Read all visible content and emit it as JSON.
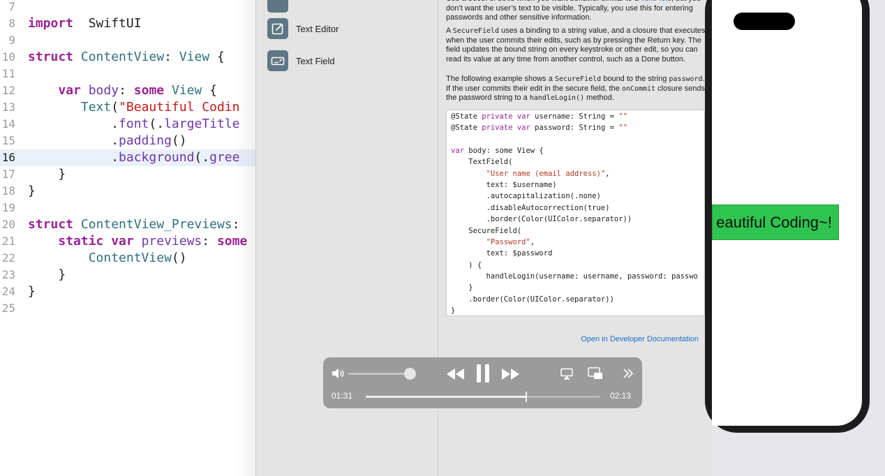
{
  "editor": {
    "lines": [
      {
        "n": "7",
        "parts": []
      },
      {
        "n": "8",
        "parts": [
          [
            "k",
            "import"
          ],
          [
            "",
            "  SwiftUI"
          ]
        ]
      },
      {
        "n": "9",
        "parts": []
      },
      {
        "n": "10",
        "parts": [
          [
            "k",
            "struct"
          ],
          [
            "",
            " "
          ],
          [
            "t",
            "ContentView"
          ],
          [
            "",
            ": "
          ],
          [
            "t",
            "View"
          ],
          [
            "",
            " {"
          ]
        ]
      },
      {
        "n": "11",
        "parts": []
      },
      {
        "n": "12",
        "parts": [
          [
            "",
            " "
          ],
          [
            "k",
            "   var"
          ],
          [
            "",
            " "
          ],
          [
            "p",
            "body"
          ],
          [
            "",
            ": "
          ],
          [
            "k",
            "some"
          ],
          [
            "",
            " "
          ],
          [
            "t",
            "View"
          ],
          [
            "",
            " {"
          ]
        ]
      },
      {
        "n": "13",
        "parts": [
          [
            "",
            "       "
          ],
          [
            "t",
            "Text"
          ],
          [
            "",
            "("
          ],
          [
            "s",
            "\"Beautiful Codin"
          ]
        ]
      },
      {
        "n": "14",
        "parts": [
          [
            "",
            "           ."
          ],
          [
            "p",
            "font"
          ],
          [
            "",
            "(."
          ],
          [
            "p",
            "largeTitle"
          ]
        ]
      },
      {
        "n": "15",
        "parts": [
          [
            "",
            "           ."
          ],
          [
            "p",
            "padding"
          ],
          [
            "",
            "()"
          ]
        ]
      },
      {
        "n": "16",
        "parts": [
          [
            "",
            "           ."
          ],
          [
            "p",
            "background"
          ],
          [
            "",
            "(."
          ],
          [
            "p",
            "gree"
          ]
        ]
      },
      {
        "n": "17",
        "parts": [
          [
            "",
            "    }"
          ]
        ]
      },
      {
        "n": "18",
        "parts": [
          [
            "",
            "}"
          ]
        ]
      },
      {
        "n": "19",
        "parts": []
      },
      {
        "n": "20",
        "parts": [
          [
            "k",
            "struct"
          ],
          [
            "",
            " "
          ],
          [
            "t",
            "ContentView_Previews"
          ],
          [
            "",
            ":"
          ]
        ]
      },
      {
        "n": "21",
        "parts": [
          [
            "",
            "    "
          ],
          [
            "k",
            "static var"
          ],
          [
            "",
            " "
          ],
          [
            "p",
            "previews"
          ],
          [
            "",
            ": "
          ],
          [
            "k",
            "some"
          ]
        ]
      },
      {
        "n": "22",
        "parts": [
          [
            "",
            "        "
          ],
          [
            "t",
            "ContentView"
          ],
          [
            "",
            "()"
          ]
        ]
      },
      {
        "n": "23",
        "parts": [
          [
            "",
            "    }"
          ]
        ]
      },
      {
        "n": "24",
        "parts": [
          [
            "",
            "}"
          ]
        ]
      },
      {
        "n": "25",
        "parts": []
      }
    ],
    "current_line": "16"
  },
  "library": {
    "items": [
      {
        "label": "Text Editor",
        "icon": "text-editor-icon"
      },
      {
        "label": "Text Field",
        "icon": "text-field-icon"
      }
    ]
  },
  "doc": {
    "p1": [
      [
        "",
        "Use a "
      ],
      [
        "m",
        "SecureField"
      ],
      [
        "",
        " when you want behavior similar to a "
      ],
      [
        "a",
        "TextField"
      ],
      [
        "",
        ", but you don’t want the user’s text to be visible. Typically, you use this for entering passwords and other sensitive information."
      ]
    ],
    "p2": [
      [
        "",
        "A "
      ],
      [
        "m",
        "SecureField"
      ],
      [
        "",
        " uses a binding to a string value, and a closure that executes when the user commits their edits, such as by pressing the Return key. The field updates the bound string on every keystroke or other edit, so you can read its value at any time from another control, such as a Done button."
      ]
    ],
    "p3": [
      [
        "",
        "The following example shows a "
      ],
      [
        "m",
        "SecureField"
      ],
      [
        "",
        " bound to the string "
      ],
      [
        "m",
        "password"
      ],
      [
        "",
        ". If the user commits their edit in the secure field, the "
      ],
      [
        "m",
        "on"
      ],
      [
        "m",
        "Commit"
      ],
      [
        "",
        " closure sends the password string to a "
      ],
      [
        "m",
        "handleLogin()"
      ],
      [
        "",
        " method."
      ]
    ],
    "code": [
      [
        [
          "",
          "@State "
        ],
        [
          "k",
          "private var"
        ],
        [
          "",
          " username: String = "
        ],
        [
          "s",
          "\"\""
        ]
      ],
      [
        [
          "",
          "@State "
        ],
        [
          "k",
          "private var"
        ],
        [
          "",
          " password: String = "
        ],
        [
          "s",
          "\"\""
        ]
      ],
      [],
      [
        [
          "k",
          "var"
        ],
        [
          "",
          " body: some View {"
        ]
      ],
      [
        [
          "",
          "    TextField("
        ]
      ],
      [
        [
          "",
          "        "
        ],
        [
          "s",
          "\"User name (email address)\""
        ],
        [
          "",
          ","
        ]
      ],
      [
        [
          "",
          "        text: $username)"
        ]
      ],
      [
        [
          "",
          "        .autocapitalization(.none)"
        ]
      ],
      [
        [
          "",
          "        .disableAutocorrection(true)"
        ]
      ],
      [
        [
          "",
          "        .border(Color(UIColor.separator))"
        ]
      ],
      [
        [
          "",
          "    SecureField("
        ]
      ],
      [
        [
          "",
          "        "
        ],
        [
          "s",
          "\"Password\""
        ],
        [
          "",
          ","
        ]
      ],
      [
        [
          "",
          "        text: $password"
        ]
      ],
      [
        [
          "",
          "    ) {"
        ]
      ],
      [
        [
          "",
          "        handleLogin(username: username, password: passwo"
        ]
      ],
      [
        [
          "",
          "    }"
        ]
      ],
      [
        [
          "",
          "    .border(Color(UIColor.separator))"
        ]
      ],
      [
        [
          "",
          "}"
        ]
      ]
    ],
    "open_docs": "Open in Developer Documentation"
  },
  "video": {
    "elapsed": "01:31",
    "remaining": "02:13",
    "progress": 0.685,
    "volume": 0.9
  },
  "preview": {
    "text": "eautiful Coding~!",
    "background": "#2fc34f"
  }
}
